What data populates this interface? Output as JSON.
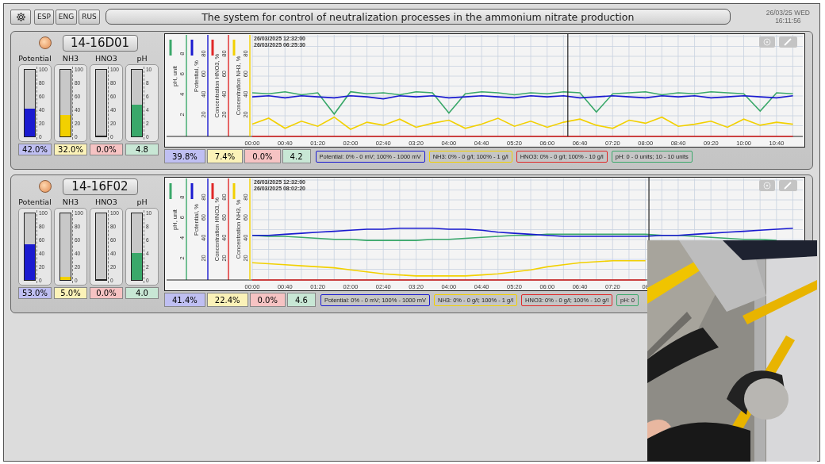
{
  "toolbar": {
    "languages": [
      {
        "label": "ESP"
      },
      {
        "label": "ENG"
      },
      {
        "label": "RUS"
      }
    ]
  },
  "title": "The system for control of neutralization processes in the ammonium nitrate production",
  "clock": {
    "date": "26/03/25 WED",
    "time": "16:11:56"
  },
  "units": [
    {
      "name": "14-16D01",
      "gauges": [
        {
          "label": "Potential",
          "level": 0.42,
          "reading": "42.0%",
          "color": "#1a1ad0",
          "scale": [
            "100",
            "80",
            "60",
            "40",
            "20",
            "0"
          ]
        },
        {
          "label": "NH3",
          "level": 0.32,
          "reading": "32.0%",
          "color": "#f2d000",
          "scale": [
            "100",
            "80",
            "60",
            "40",
            "20",
            "0"
          ]
        },
        {
          "label": "HNO3",
          "level": 0,
          "reading": "0.0%",
          "color": "#e02828",
          "scale": [
            "100",
            "80",
            "60",
            "40",
            "20",
            "0"
          ]
        },
        {
          "label": "pH",
          "level": 0.48,
          "reading": "4.8",
          "color": "#3aa86a",
          "scale": [
            "10",
            "8",
            "6",
            "4",
            "2",
            "0"
          ]
        }
      ],
      "chart": {
        "timestamps": [
          "26/03/2025 12:32:00",
          "26/03/2025 06:25:30"
        ],
        "axes": [
          {
            "title": "pH, unit",
            "ticks": [
              "8",
              "6",
              "4",
              "2"
            ]
          },
          {
            "title": "Potential, %",
            "ticks": [
              "80",
              "60",
              "40",
              "20"
            ]
          },
          {
            "title": "Concentration HNO3, %",
            "ticks": [
              "80",
              "60",
              "40",
              "20"
            ]
          },
          {
            "title": "Concentration NH3, %"
          }
        ],
        "chart_data": {
          "type": "line",
          "xlim": [
            0,
            11.2
          ],
          "ylim": [
            0,
            100
          ],
          "yticks": [
            80,
            60,
            40,
            20
          ],
          "grid": true,
          "ref_lines": [
            {
              "axis": "x",
              "value": 6.42
            }
          ],
          "x": [
            0,
            0.3333,
            0.6667,
            1,
            1.3333,
            1.6667,
            2,
            2.3333,
            2.6667,
            3,
            3.3333,
            3.6667,
            4,
            4.3333,
            4.6667,
            5,
            5.3333,
            5.6667,
            6,
            6.3333,
            6.6667,
            7,
            7.3333,
            7.6667,
            8,
            8.3333,
            8.6667,
            9,
            9.3333,
            9.6667,
            10,
            10.3333,
            10.6667,
            11
          ],
          "xticks": [
            {
              "value": 0,
              "label": "00:00"
            },
            {
              "value": 0.6667,
              "label": "00:40"
            },
            {
              "value": 1.3333,
              "label": "01:20"
            },
            {
              "value": 2,
              "label": "02:00"
            },
            {
              "value": 2.6667,
              "label": "02:40"
            },
            {
              "value": 3.3333,
              "label": "03:20"
            },
            {
              "value": 4,
              "label": "04:00"
            },
            {
              "value": 4.6667,
              "label": "04:40"
            },
            {
              "value": 5.3333,
              "label": "05:20"
            },
            {
              "value": 6,
              "label": "06:00"
            },
            {
              "value": 6.6667,
              "label": "06:40"
            },
            {
              "value": 7.3333,
              "label": "07:20"
            },
            {
              "value": 8,
              "label": "08:00"
            },
            {
              "value": 8.6667,
              "label": "08:40"
            },
            {
              "value": 9.3333,
              "label": "09:20"
            },
            {
              "value": 10,
              "label": "10:00"
            },
            {
              "value": 10.6667,
              "label": "10:40"
            }
          ],
          "series": [
            {
              "color": "#3aa86a",
              "values": [
                43,
                42,
                44,
                41,
                43,
                22,
                44,
                42,
                43,
                41,
                44,
                43,
                23,
                42,
                44,
                43,
                41,
                43,
                42,
                44,
                43,
                24,
                42,
                43,
                44,
                41,
                43,
                42,
                44,
                43,
                42,
                25,
                43,
                42
              ]
            },
            {
              "color": "#1a1ad0",
              "values": [
                39,
                40,
                38,
                40,
                39,
                38,
                40,
                39,
                37,
                40,
                39,
                40,
                38,
                39,
                40,
                39,
                38,
                40,
                39,
                40,
                38,
                39,
                40,
                39,
                38,
                40,
                39,
                40,
                38,
                39,
                40,
                39,
                38,
                40
              ]
            },
            {
              "color": "#e02828",
              "values": [
                0,
                0,
                0,
                0,
                0,
                0,
                0,
                0,
                0,
                0,
                0,
                0,
                0,
                0,
                0,
                0,
                0,
                0,
                0,
                0,
                0,
                0,
                0,
                0,
                0,
                0,
                0,
                0,
                0,
                0,
                0,
                0,
                0,
                0
              ]
            },
            {
              "color": "#f2d000",
              "values": [
                12,
                18,
                8,
                15,
                10,
                19,
                7,
                14,
                11,
                17,
                9,
                13,
                16,
                8,
                12,
                18,
                10,
                15,
                9,
                14,
                17,
                11,
                8,
                16,
                13,
                19,
                10,
                12,
                15,
                9,
                17,
                11,
                14,
                12
              ]
            }
          ]
        },
        "readings": [
          "39.8%",
          "7.4%",
          "0.0%",
          "4.2"
        ],
        "legends": [
          "Potential: 0% - 0 mV; 100% - 1000 mV",
          "NH3: 0% - 0 g/l; 100% - 1 g/l",
          "HNO3: 0% - 0 g/l; 100% - 10 g/l",
          "pH: 0 - 0 units; 10 - 10 units"
        ]
      }
    },
    {
      "name": "14-16F02",
      "gauges": [
        {
          "label": "Potential",
          "level": 0.53,
          "reading": "53.0%",
          "color": "#1a1ad0",
          "scale": [
            "100",
            "80",
            "60",
            "40",
            "20",
            "0"
          ]
        },
        {
          "label": "NH3",
          "level": 0.05,
          "reading": "5.0%",
          "color": "#f2d000",
          "scale": [
            "100",
            "80",
            "60",
            "40",
            "20",
            "0"
          ]
        },
        {
          "label": "HNO3",
          "level": 0,
          "reading": "0.0%",
          "color": "#e02828",
          "scale": [
            "100",
            "80",
            "60",
            "40",
            "20",
            "0"
          ]
        },
        {
          "label": "pH",
          "level": 0.4,
          "reading": "4.0",
          "color": "#3aa86a",
          "scale": [
            "10",
            "8",
            "6",
            "4",
            "2",
            "0"
          ]
        }
      ],
      "chart": {
        "timestamps": [
          "26/03/2025 12:32:00",
          "26/03/2025 08:02:20"
        ],
        "axes": [
          {
            "title": "pH, unit",
            "ticks": [
              "8",
              "6",
              "4",
              "2"
            ]
          },
          {
            "title": "Potential, %",
            "ticks": [
              "80",
              "60",
              "40",
              "20"
            ]
          },
          {
            "title": "Concentration HNO3, %",
            "ticks": [
              "80",
              "60",
              "40",
              "20"
            ]
          },
          {
            "title": "Concentration NH3, %"
          }
        ],
        "chart_data": {
          "type": "line",
          "xlim": [
            0,
            11.2
          ],
          "ylim": [
            0,
            100
          ],
          "yticks": [
            80,
            60,
            40,
            20
          ],
          "grid": true,
          "ref_lines": [
            {
              "axis": "x",
              "value": 8.07
            }
          ],
          "x": [
            0,
            0.3333,
            0.6667,
            1,
            1.3333,
            1.6667,
            2,
            2.3333,
            2.6667,
            3,
            3.3333,
            3.6667,
            4,
            4.3333,
            4.6667,
            5,
            5.3333,
            5.6667,
            6,
            6.3333,
            6.6667,
            7,
            7.3333,
            7.6667,
            8,
            8.3333,
            8.6667,
            9,
            9.3333,
            9.6667,
            10,
            10.3333,
            10.6667,
            11
          ],
          "xticks": [
            {
              "value": 0,
              "label": "00:00"
            },
            {
              "value": 0.6667,
              "label": "00:40"
            },
            {
              "value": 1.3333,
              "label": "01:20"
            },
            {
              "value": 2,
              "label": "02:00"
            },
            {
              "value": 2.6667,
              "label": "02:40"
            },
            {
              "value": 3.3333,
              "label": "03:20"
            },
            {
              "value": 4,
              "label": "04:00"
            },
            {
              "value": 4.6667,
              "label": "04:40"
            },
            {
              "value": 5.3333,
              "label": "05:20"
            },
            {
              "value": 6,
              "label": "06:00"
            },
            {
              "value": 6.6667,
              "label": "06:40"
            },
            {
              "value": 7.3333,
              "label": "07:20"
            },
            {
              "value": 8,
              "label": "08"
            }
          ],
          "series": [
            {
              "color": "#3aa86a",
              "values": [
                44,
                43,
                43,
                42,
                41,
                40,
                40,
                39,
                39,
                39,
                39,
                40,
                40,
                41,
                42,
                43,
                44,
                44,
                45,
                45,
                45,
                45,
                45,
                45,
                45,
                44,
                44,
                43,
                42,
                41,
                40,
                40,
                39,
                null
              ]
            },
            {
              "color": "#1a1ad0",
              "values": [
                44,
                44,
                45,
                46,
                47,
                48,
                49,
                50,
                50,
                51,
                51,
                51,
                50,
                50,
                49,
                47,
                46,
                45,
                44,
                43,
                43,
                43,
                43,
                43,
                43,
                44,
                44,
                45,
                46,
                47,
                48,
                49,
                50,
                51
              ]
            },
            {
              "color": "#e02828",
              "values": [
                0,
                0,
                0,
                0,
                0,
                0,
                0,
                0,
                0,
                0,
                0,
                0,
                0,
                0,
                0,
                0,
                0,
                0,
                0,
                0,
                0,
                0,
                0,
                0,
                0,
                null,
                null,
                null,
                null,
                null,
                null,
                null,
                null,
                null
              ]
            },
            {
              "color": "#f2d000",
              "values": [
                17,
                16,
                15,
                14,
                13,
                12,
                10,
                8,
                6,
                5,
                4,
                4,
                4,
                4,
                5,
                6,
                8,
                10,
                13,
                15,
                17,
                18,
                19,
                19,
                19,
                null,
                null,
                null,
                null,
                null,
                null,
                null,
                null,
                null
              ]
            }
          ]
        },
        "readings": [
          "41.4%",
          "22.4%",
          "0.0%",
          "4.6"
        ],
        "legends": [
          "Potential: 0% - 0 mV; 100% - 1000 mV",
          "NH3: 0% - 0 g/l; 100% - 1 g/l",
          "HNO3: 0% - 0 g/l; 100% - 10 g/l",
          "pH: 0"
        ]
      }
    }
  ]
}
